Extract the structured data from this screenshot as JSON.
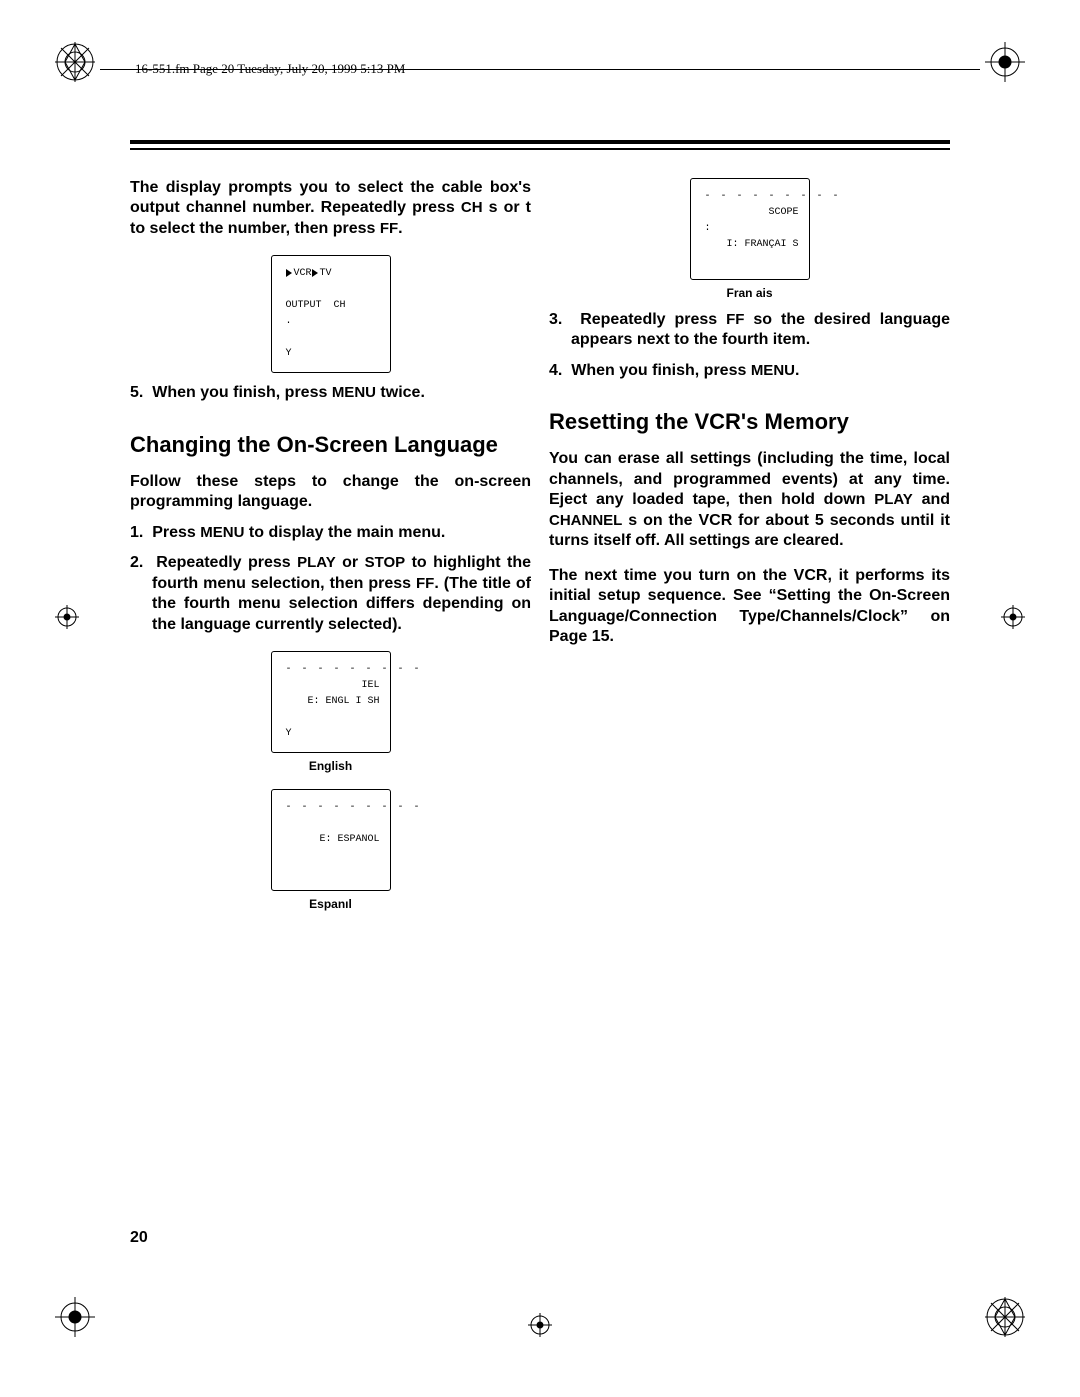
{
  "header": {
    "meta": "16-551.fm  Page 20  Tuesday, July 20, 1999  5:13 PM"
  },
  "left": {
    "intro_1": "The display prompts you to select the cable box's output channel number. Repeatedly press ",
    "intro_ch": "CH",
    "intro_2": " s or t to select the number, then press ",
    "intro_ff": "FF",
    "intro_3": ".",
    "disp_vcr": {
      "l1a": "VCR",
      "l1b": "TV",
      "l2": "OUTPUT  CH",
      "l3": ".",
      "l4": "Y"
    },
    "step5_a": "When you finish, press ",
    "step5_menu": "MENU",
    "step5_b": " twice.",
    "h2": "Changing the On-Screen Language",
    "follow": "Follow these steps to change the on-screen programming language.",
    "s1_a": "Press ",
    "s1_menu": "MENU",
    "s1_b": " to display the main menu.",
    "s2_a": "Repeatedly press ",
    "s2_play": "PLAY",
    "s2_b": " or ",
    "s2_stop": "STOP",
    "s2_c": " to highlight the fourth menu selection, then press ",
    "s2_ff": "FF",
    "s2_d": ". (The title of the fourth menu selection differs depending on the language currently selected).",
    "disp_eng": {
      "l1": "IEL",
      "l2": "E: ENGL I SH",
      "l3": "Y",
      "cap": "English"
    },
    "disp_esp": {
      "l2": "E: ESPANOL",
      "cap": "Espanıl"
    }
  },
  "right": {
    "disp_fr": {
      "l1": "SCOPE",
      "l2": ":",
      "l3": "I: FRANÇAI S",
      "cap": "Fran  ais"
    },
    "s3_a": "Repeatedly press ",
    "s3_ff": "FF",
    "s3_b": " so the desired language appears next to the fourth item.",
    "s4_a": "When you finish, press ",
    "s4_menu": "MENU",
    "s4_b": ".",
    "h2": "Resetting the VCR's Memory",
    "p1_a": "You can erase all settings (including the time, local channels, and programmed events) at any time. Eject any loaded tape, then hold down ",
    "p1_play": "PLAY",
    "p1_b": " and ",
    "p1_ch": "CHANNEL",
    "p1_c": " s on the VCR for about 5 seconds until it turns itself off. All settings are cleared.",
    "p2": "The next time you turn on the VCR, it performs its initial setup sequence. See “Setting the On-Screen Language/Connection Type/Channels/Clock” on Page 15."
  },
  "pagenum": "20"
}
